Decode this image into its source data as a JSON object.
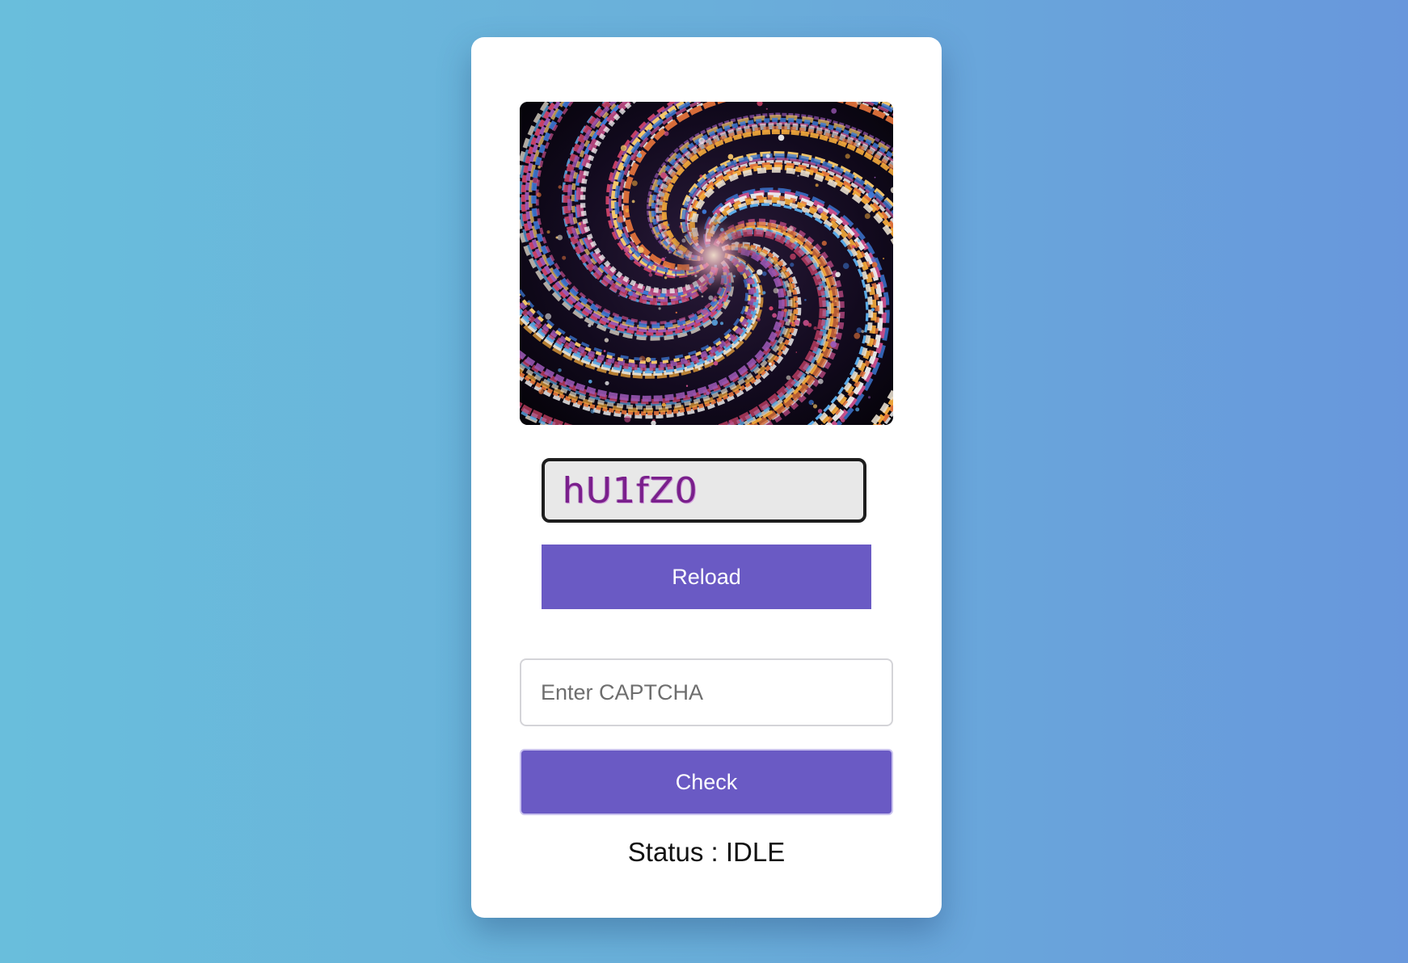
{
  "captcha": {
    "code": "hU1fZ0",
    "reload_label": "Reload"
  },
  "form": {
    "input_placeholder": "Enter CAPTCHA",
    "input_value": "",
    "check_label": "Check"
  },
  "status": {
    "label": "Status",
    "separator": " : ",
    "value": "IDLE"
  },
  "colors": {
    "accent": "#6a5ac4",
    "captcha_text": "#7a1f8c",
    "background_from": "#69bedc",
    "background_to": "#6897dc"
  },
  "hero": {
    "description": "colorful-spiral-artwork"
  }
}
